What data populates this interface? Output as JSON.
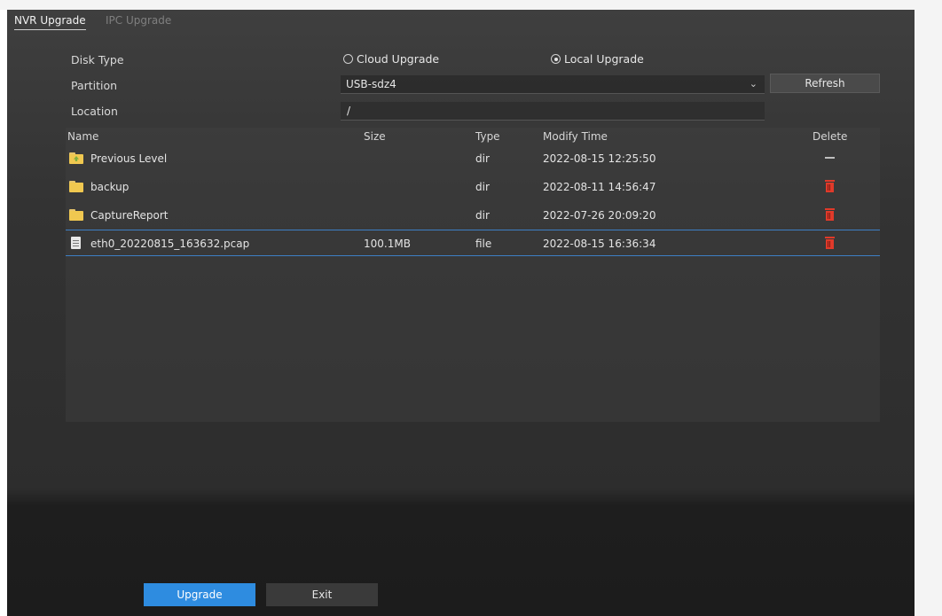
{
  "tabs": [
    {
      "label": "NVR Upgrade",
      "active": true
    },
    {
      "label": "IPC Upgrade",
      "active": false
    }
  ],
  "form": {
    "disk_type_label": "Disk Type",
    "partition_label": "Partition",
    "location_label": "Location",
    "cloud_upgrade_label": "Cloud Upgrade",
    "local_upgrade_label": "Local Upgrade",
    "selected_disk_type": "Local Upgrade",
    "partition_value": "USB-sdz4",
    "location_value": "/",
    "refresh_label": "Refresh"
  },
  "table": {
    "headers": [
      "Name",
      "Size",
      "Type",
      "Modify Time",
      "Delete"
    ],
    "rows": [
      {
        "name": "Previous Level",
        "size": "",
        "type": "dir",
        "modified": "2022-08-15 12:25:50",
        "icon": "folder-up-icon",
        "delete": "none"
      },
      {
        "name": "backup",
        "size": "",
        "type": "dir",
        "modified": "2022-08-11 14:56:47",
        "icon": "folder-icon",
        "delete": "trash"
      },
      {
        "name": "CaptureReport",
        "size": "",
        "type": "dir",
        "modified": "2022-07-26 20:09:20",
        "icon": "folder-icon",
        "delete": "trash"
      },
      {
        "name": "eth0_20220815_163632.pcap",
        "size": "100.1MB",
        "type": "file",
        "modified": "2022-08-15 16:36:34",
        "icon": "file-icon",
        "delete": "trash",
        "selected": true
      }
    ]
  },
  "buttons": {
    "upgrade_label": "Upgrade",
    "exit_label": "Exit"
  },
  "colors": {
    "accent": "#2e8ce0",
    "selection_border": "#3d7fc5",
    "delete_icon": "#e03a2a",
    "folder": "#f0c850"
  }
}
